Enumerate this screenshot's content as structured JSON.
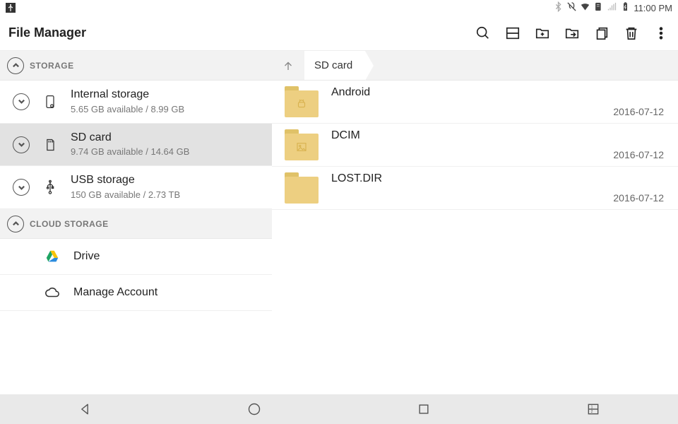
{
  "status": {
    "time": "11:00 PM"
  },
  "app": {
    "title": "File Manager"
  },
  "sidebar": {
    "sections": [
      {
        "label": "STORAGE",
        "items": [
          {
            "name": "Internal storage",
            "sub": "5.65 GB available / 8.99 GB"
          },
          {
            "name": "SD card",
            "sub": "9.74 GB available / 14.64 GB"
          },
          {
            "name": "USB storage",
            "sub": "150 GB available / 2.73 TB"
          }
        ]
      },
      {
        "label": "CLOUD STORAGE",
        "items": [
          {
            "name": "Drive"
          },
          {
            "name": "Manage Account"
          }
        ]
      }
    ]
  },
  "breadcrumb": {
    "current": "SD card"
  },
  "files": [
    {
      "name": "Android",
      "date": "2016-07-12",
      "icon": "android"
    },
    {
      "name": "DCIM",
      "date": "2016-07-12",
      "icon": "image"
    },
    {
      "name": "LOST.DIR",
      "date": "2016-07-12",
      "icon": "none"
    }
  ]
}
